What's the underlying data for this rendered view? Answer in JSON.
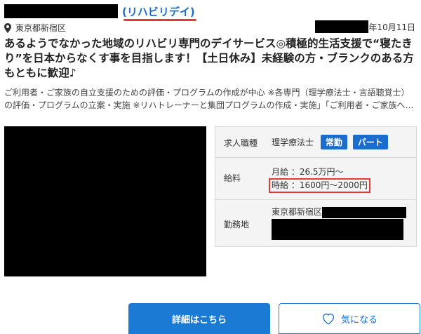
{
  "header": {
    "company_name": "(リハビリデイ)",
    "location": "東京都新宿区",
    "date_suffix": "年10月11日"
  },
  "job": {
    "title": "あるようでなかった地域のリハビリ専門のデイサービス◎積極的生活支援で“寝たきり”を日本からなくす事を目指します！【土日休み】未経験の方・ブランクのある方もともに歓迎♪",
    "description": "ご利用者・ご家族の自立支援のための評価・プログラムの作成が中心 ※各専門（理学療法士・言語聴覚士）の評価・プログラムの立案・実施 ※リハトレーナーと集団プログラムの作成・実施」「ご利用者・ご家族へ…"
  },
  "info": {
    "job_type_label": "求人職種",
    "job_type_value": "理学療法士",
    "badges": [
      "常勤",
      "パート"
    ],
    "salary_label": "給料",
    "salary_monthly": "月給 ：26.5万円～",
    "salary_hourly": "時給 ：1600円～2000円",
    "workplace_label": "勤務地",
    "workplace_value": "東京都新宿区"
  },
  "buttons": {
    "detail": "詳細はこちら",
    "favorite": "気になる"
  },
  "colors": {
    "brand_blue": "#1a7ad4",
    "highlight_red": "#e53935"
  },
  "icons": {
    "location": "map-pin-icon",
    "favorite": "heart-icon"
  }
}
